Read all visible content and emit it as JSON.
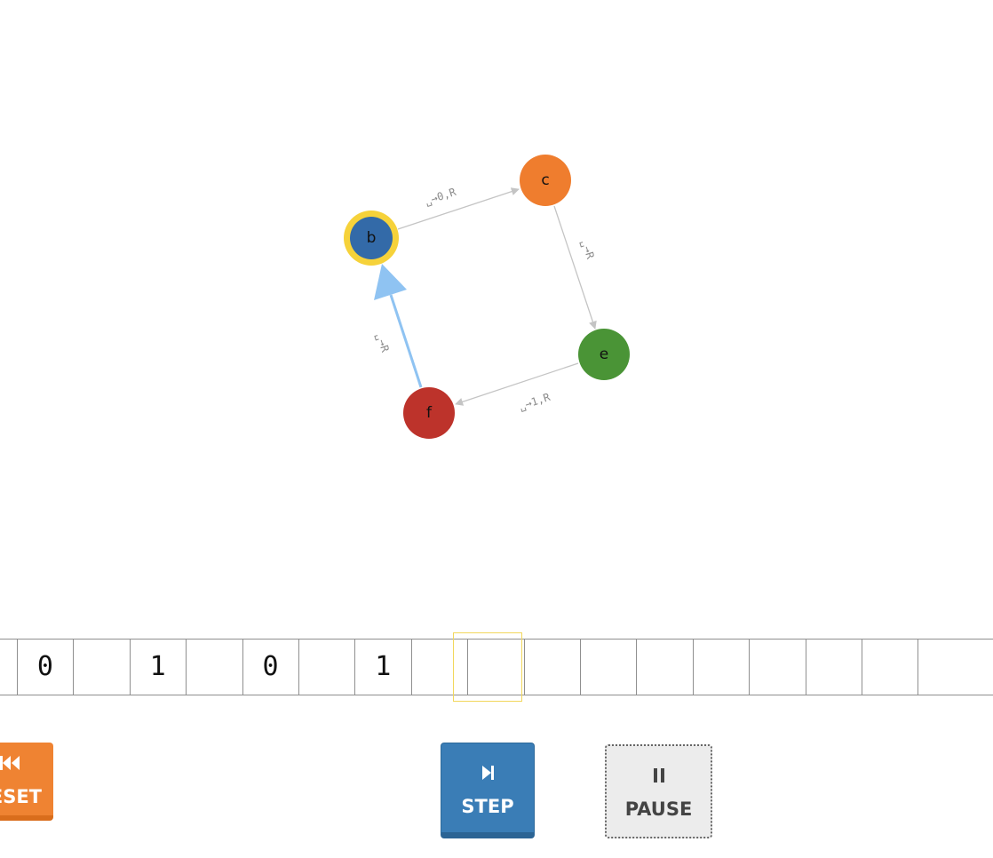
{
  "diagram": {
    "nodes": [
      {
        "id": "b",
        "label": "b",
        "color": "#336aa8",
        "current": true,
        "ring_color": "#f6d23a"
      },
      {
        "id": "c",
        "label": "c",
        "color": "#ef7d2e",
        "current": false
      },
      {
        "id": "e",
        "label": "e",
        "color": "#4a9436",
        "current": false
      },
      {
        "id": "f",
        "label": "f",
        "color": "#bd332b",
        "current": false
      }
    ],
    "edges": [
      {
        "from": "b",
        "to": "c",
        "label": "␣→0,R",
        "active": false
      },
      {
        "from": "c",
        "to": "e",
        "label": "␣→R",
        "active": false
      },
      {
        "from": "e",
        "to": "f",
        "label": "␣→1,R",
        "active": false
      },
      {
        "from": "f",
        "to": "b",
        "label": "␣→R",
        "active": true
      }
    ],
    "edge_color": "#c4c4c4",
    "active_edge_color": "#8fc3f2"
  },
  "tape": {
    "cells": [
      "",
      "0",
      "",
      "1",
      "",
      "0",
      "",
      "1",
      "",
      "",
      "",
      "",
      "",
      "",
      "",
      "",
      "",
      ""
    ],
    "head_index": 8,
    "head_color": "#f2d75c"
  },
  "controls": {
    "reset": {
      "icon": "⏮",
      "label": "RESET",
      "visible_label": "ESET",
      "color": "#ef8332"
    },
    "step": {
      "icon": "⏭",
      "label": "STEP",
      "color": "#3a7db6"
    },
    "pause": {
      "icon": "⏸",
      "label": "PAUSE"
    }
  }
}
